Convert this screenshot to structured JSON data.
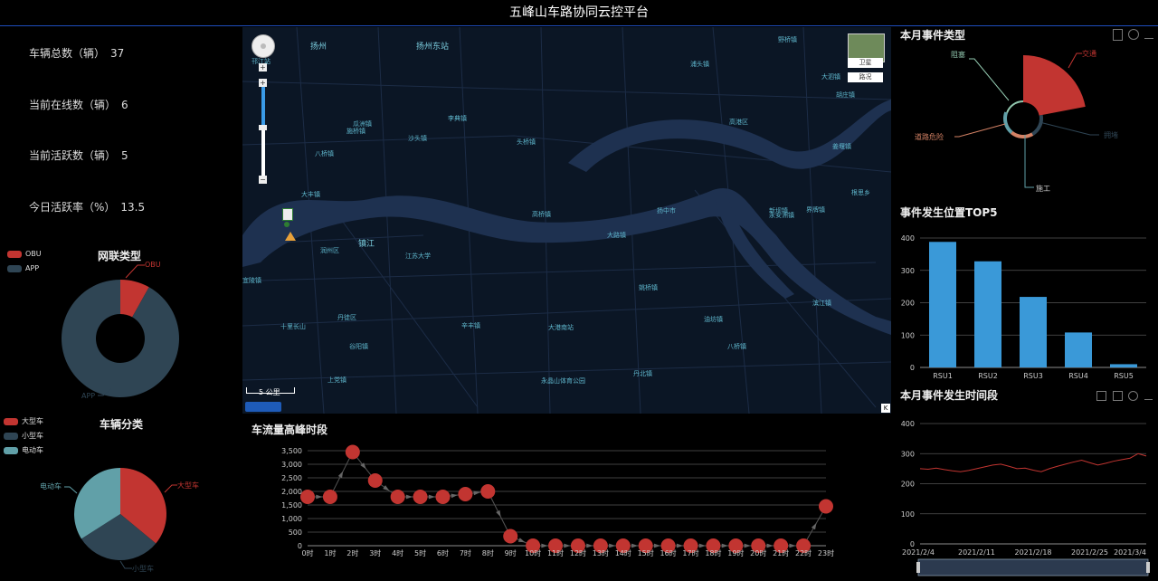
{
  "header": {
    "title": "五峰山车路协同云控平台"
  },
  "stats": [
    {
      "label": "车辆总数（辆）",
      "value": "37"
    },
    {
      "label": "当前在线数（辆）",
      "value": "6"
    },
    {
      "label": "当前活跃数（辆）",
      "value": "5"
    },
    {
      "label": "今日活跃率（%）",
      "value": "13.5"
    }
  ],
  "network": {
    "title": "网联类型",
    "legend": [
      {
        "label": "OBU",
        "color": "#c23531"
      },
      {
        "label": "APP",
        "color": "#2f4554"
      }
    ],
    "callouts": {
      "obu": "OBU",
      "app": "APP"
    }
  },
  "vehicle_class": {
    "title": "车辆分类",
    "legend": [
      {
        "label": "大型车",
        "color": "#c23531"
      },
      {
        "label": "小型车",
        "color": "#2f4554"
      },
      {
        "label": "电动车",
        "color": "#61a0a8"
      }
    ],
    "callouts": {
      "large": "大型车",
      "small": "小型车",
      "ev": "电动车"
    }
  },
  "map": {
    "buttons": {
      "satellite": "卫星",
      "traffic": "路况"
    },
    "scale": "5 公里",
    "labels": [
      {
        "t": "扬州",
        "big": true
      },
      {
        "t": "扬州东站",
        "big": true
      },
      {
        "t": "邗江站"
      },
      {
        "t": "瓜洲镇"
      },
      {
        "t": "施桥镇"
      },
      {
        "t": "李典镇"
      },
      {
        "t": "沙头镇"
      },
      {
        "t": "头桥镇"
      },
      {
        "t": "高港区"
      },
      {
        "t": "八桥镇"
      },
      {
        "t": "大丰镇"
      },
      {
        "t": "高桥镇"
      },
      {
        "t": "扬中市"
      },
      {
        "t": "大路镇"
      },
      {
        "t": "新坝镇"
      },
      {
        "t": "镇江",
        "big": true
      },
      {
        "t": "润州区"
      },
      {
        "t": "江苏大学"
      },
      {
        "t": "丹徒区"
      },
      {
        "t": "辛丰镇"
      },
      {
        "t": "大港南站"
      },
      {
        "t": "姚桥镇"
      },
      {
        "t": "油坊镇"
      },
      {
        "t": "八桥镇"
      },
      {
        "t": "十里长山"
      },
      {
        "t": "谷阳镇"
      },
      {
        "t": "上党镇"
      },
      {
        "t": "永晶山体育公园"
      },
      {
        "t": "丹北镇"
      },
      {
        "t": "界牌镇"
      },
      {
        "t": "滨江镇"
      },
      {
        "t": "永安洲镇"
      },
      {
        "t": "野桥镇"
      },
      {
        "t": "大泗镇"
      },
      {
        "t": "胡庄镇"
      },
      {
        "t": "姜堰镇"
      },
      {
        "t": "根思乡"
      },
      {
        "t": "浦头镇"
      },
      {
        "t": "宜陵镇"
      }
    ]
  },
  "traffic": {
    "title": "车流量高峰时段",
    "yticks": [
      "0",
      "500",
      "1,000",
      "1,500",
      "2,000",
      "2,500",
      "3,000",
      "3,500"
    ]
  },
  "event_types": {
    "title": "本月事件类型",
    "labels": {
      "jam": "交通",
      "block": "阻塞",
      "hazard": "道路危险",
      "construction": "施工",
      "other": "拥堵"
    },
    "tool_icons": [
      "document-icon",
      "refresh-icon",
      "download-icon"
    ]
  },
  "top5": {
    "title": "事件发生位置TOP5"
  },
  "timeline": {
    "title": "本月事件发生时间段"
  },
  "chart_data": [
    {
      "type": "pie",
      "title": "网联类型",
      "categories": [
        "OBU",
        "APP"
      ],
      "values": [
        3,
        34
      ],
      "legend_position": "top-left"
    },
    {
      "type": "pie",
      "title": "车辆分类",
      "categories": [
        "大型车",
        "小型车",
        "电动车"
      ],
      "values": [
        36,
        30,
        34
      ],
      "legend_position": "top-left"
    },
    {
      "type": "line",
      "title": "车流量高峰时段",
      "categories": [
        "0时",
        "1时",
        "2时",
        "3时",
        "4时",
        "5时",
        "6时",
        "7时",
        "8时",
        "9时",
        "10时",
        "11时",
        "12时",
        "13时",
        "14时",
        "15时",
        "16时",
        "17时",
        "18时",
        "19时",
        "20时",
        "21时",
        "22时",
        "23时"
      ],
      "values": [
        1800,
        1800,
        3450,
        2400,
        1800,
        1800,
        1800,
        1900,
        2000,
        350,
        0,
        0,
        0,
        0,
        0,
        0,
        0,
        0,
        0,
        0,
        0,
        0,
        0,
        1450
      ],
      "ylim": [
        0,
        3500
      ],
      "grid": true
    },
    {
      "type": "pie",
      "title": "本月事件类型",
      "categories": [
        "交通",
        "阻塞",
        "道路危险",
        "施工",
        "拥堵"
      ],
      "values": [
        70,
        8,
        8,
        8,
        6
      ]
    },
    {
      "type": "bar",
      "title": "事件发生位置TOP5",
      "categories": [
        "RSU1",
        "RSU2",
        "RSU3",
        "RSU4",
        "RSU5"
      ],
      "values": [
        388,
        328,
        218,
        108,
        10
      ],
      "ylim": [
        0,
        400
      ],
      "grid": true
    },
    {
      "type": "line",
      "title": "本月事件发生时间段",
      "x": [
        "2021/2/4",
        "2021/2/5",
        "2021/2/6",
        "2021/2/7",
        "2021/2/8",
        "2021/2/9",
        "2021/2/10",
        "2021/2/11",
        "2021/2/12",
        "2021/2/13",
        "2021/2/14",
        "2021/2/15",
        "2021/2/16",
        "2021/2/17",
        "2021/2/18",
        "2021/2/19",
        "2021/2/20",
        "2021/2/21",
        "2021/2/22",
        "2021/2/23",
        "2021/2/24",
        "2021/2/25",
        "2021/2/26",
        "2021/2/27",
        "2021/2/28",
        "2021/3/1",
        "2021/3/2",
        "2021/3/3",
        "2021/3/4"
      ],
      "xticks": [
        "2021/2/4",
        "2021/2/11",
        "2021/2/18",
        "2021/2/25",
        "2021/3/4"
      ],
      "values": [
        250,
        248,
        252,
        247,
        243,
        240,
        244,
        250,
        256,
        262,
        265,
        258,
        250,
        252,
        245,
        240,
        250,
        258,
        265,
        272,
        278,
        270,
        262,
        268,
        275,
        280,
        285,
        300,
        292
      ],
      "ylim": [
        0,
        400
      ],
      "grid": true
    }
  ]
}
